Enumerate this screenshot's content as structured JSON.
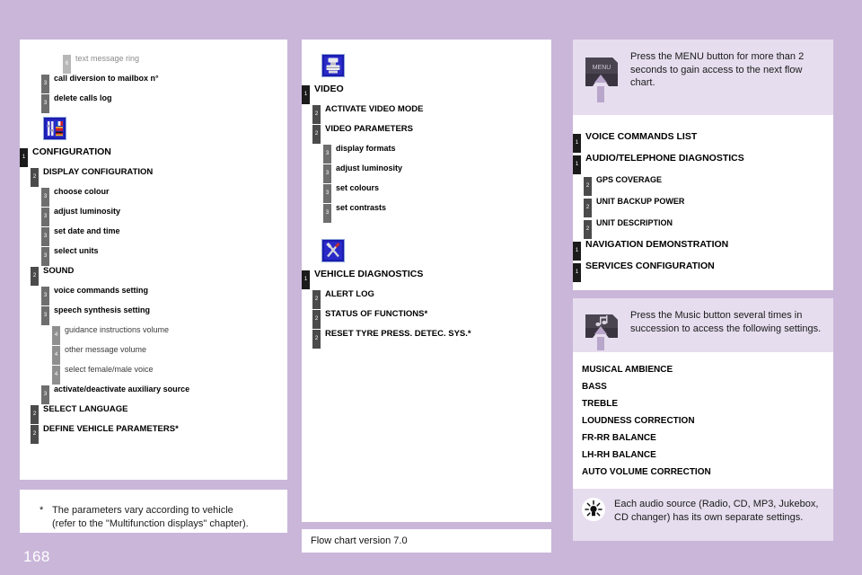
{
  "page": {
    "page_number": "168",
    "background_color": "#c9b6d9",
    "flow_chart_version": "Flow chart version 7.0"
  },
  "left_column": {
    "continued_rows": [
      {
        "level": 6,
        "label": "text message ring"
      },
      {
        "level": 3,
        "label": "call diversion to mailbox n°"
      },
      {
        "level": 3,
        "label": "delete calls log"
      }
    ],
    "section": {
      "icon": "configuration-icon",
      "rows": [
        {
          "level": 1,
          "label": "CONFIGURATION"
        },
        {
          "level": 2,
          "label": "DISPLAY CONFIGURATION"
        },
        {
          "level": 3,
          "label": "choose colour"
        },
        {
          "level": 3,
          "label": "adjust luminosity"
        },
        {
          "level": 3,
          "label": "set date and time"
        },
        {
          "level": 3,
          "label": "select units"
        },
        {
          "level": 2,
          "label": "SOUND"
        },
        {
          "level": 3,
          "label": "voice commands setting"
        },
        {
          "level": 3,
          "label": "speech synthesis setting"
        },
        {
          "level": 4,
          "label": "guidance instructions volume"
        },
        {
          "level": 4,
          "label": "other message volume"
        },
        {
          "level": 4,
          "label": "select female/male voice"
        },
        {
          "level": 3,
          "label": "activate/deactivate auxiliary source"
        },
        {
          "level": 2,
          "label": "SELECT LANGUAGE"
        },
        {
          "level": 2,
          "label": "DEFINE VEHICLE PARAMETERS*"
        }
      ]
    },
    "footnote": {
      "marker": "*",
      "line1": "The parameters vary according to vehicle",
      "line2": "(refer to the \"Multifunction displays\" chapter)."
    }
  },
  "middle_column": {
    "sections": [
      {
        "icon": "video-icon",
        "rows": [
          {
            "level": 1,
            "label": "VIDEO"
          },
          {
            "level": 2,
            "label": "ACTIVATE VIDEO MODE"
          },
          {
            "level": 2,
            "label": "VIDEO PARAMETERS"
          },
          {
            "level": 3,
            "label": "display formats"
          },
          {
            "level": 3,
            "label": "adjust luminosity"
          },
          {
            "level": 3,
            "label": "set colours"
          },
          {
            "level": 3,
            "label": "set contrasts"
          }
        ]
      },
      {
        "icon": "vehicle-diagnostics-icon",
        "rows": [
          {
            "level": 1,
            "label": "VEHICLE DIAGNOSTICS"
          },
          {
            "level": 2,
            "label": "ALERT LOG"
          },
          {
            "level": 2,
            "label": "STATUS OF FUNCTIONS*"
          },
          {
            "level": 2,
            "label": "RESET TYRE PRESS. DETEC. SYS.*"
          }
        ]
      }
    ]
  },
  "right_column": {
    "menu_callout": {
      "icon": "menu-button-icon",
      "icon_label": "MENU",
      "text": "Press the MENU button for more than 2 seconds to gain access to the next flow chart."
    },
    "menu_rows": [
      {
        "level": 1,
        "label": "VOICE COMMANDS LIST"
      },
      {
        "level": 1,
        "label": "AUDIO/TELEPHONE DIAGNOSTICS"
      },
      {
        "level": 2,
        "label": "GPS COVERAGE"
      },
      {
        "level": 2,
        "label": "UNIT BACKUP POWER"
      },
      {
        "level": 2,
        "label": "UNIT DESCRIPTION"
      },
      {
        "level": 1,
        "label": "NAVIGATION DEMONSTRATION"
      },
      {
        "level": 1,
        "label": "SERVICES CONFIGURATION"
      }
    ],
    "music_callout": {
      "icon": "music-button-icon",
      "text": "Press the Music button several times in succession to access the following settings."
    },
    "music_settings": [
      "MUSICAL AMBIENCE",
      "BASS",
      "TREBLE",
      "LOUDNESS CORRECTION",
      "FR-RR BALANCE",
      "LH-RH BALANCE",
      "AUTO VOLUME CORRECTION"
    ],
    "tip": {
      "icon": "bulb-icon",
      "text": "Each audio source (Radio, CD, MP3, Jukebox, CD changer) has its own separate settings."
    }
  }
}
